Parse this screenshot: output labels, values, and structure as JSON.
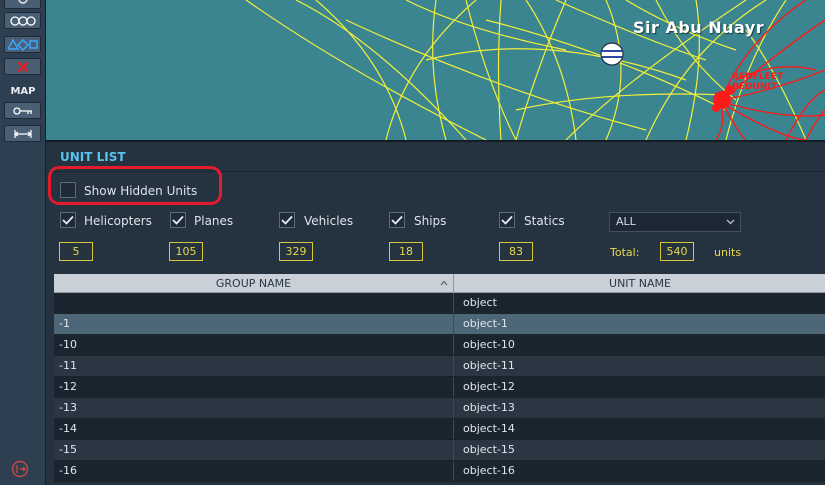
{
  "toolbar": {
    "icons": [
      "circle-icon",
      "three-circles-icon",
      "shapes-icon",
      "delete-icon"
    ],
    "map_label": "MAP",
    "map_icons": [
      "key-icon",
      "ruler-icon"
    ],
    "exit_icon": "exit-icon"
  },
  "map": {
    "place_name": "Sir Abu Nuayr",
    "marker_labels": [
      "REDFLEET",
      "REDUNIT"
    ]
  },
  "unit_list": {
    "title": "UNIT LIST",
    "show_hidden_label": "Show Hidden Units",
    "show_hidden_checked": false,
    "filters": [
      {
        "label": "Helicopters",
        "checked": true,
        "count": "5"
      },
      {
        "label": "Planes",
        "checked": true,
        "count": "105"
      },
      {
        "label": "Vehicles",
        "checked": true,
        "count": "329"
      },
      {
        "label": "Ships",
        "checked": true,
        "count": "18"
      },
      {
        "label": "Statics",
        "checked": true,
        "count": "83"
      }
    ],
    "coalition_select": "ALL",
    "total_label": "Total:",
    "total_value": "540",
    "units_label": "units"
  },
  "table": {
    "columns": [
      "GROUP NAME",
      "UNIT NAME"
    ],
    "rows": [
      {
        "group": "",
        "unit": "object"
      },
      {
        "group": "-1",
        "unit": "object-1"
      },
      {
        "group": "-10",
        "unit": "object-10"
      },
      {
        "group": "-11",
        "unit": "object-11"
      },
      {
        "group": "-12",
        "unit": "object-12"
      },
      {
        "group": "-13",
        "unit": "object-13"
      },
      {
        "group": "-14",
        "unit": "object-14"
      },
      {
        "group": "-15",
        "unit": "object-15"
      },
      {
        "group": "-16",
        "unit": "object-16"
      }
    ],
    "selected_row": 1
  },
  "colors": {
    "accent": "#5bc3ef",
    "count_border": "#d7c63a",
    "highlight": "#e21b2e",
    "map_water": "#3a8590",
    "route_lines": "#f2f03a",
    "red_units": "#ff1a1a"
  }
}
